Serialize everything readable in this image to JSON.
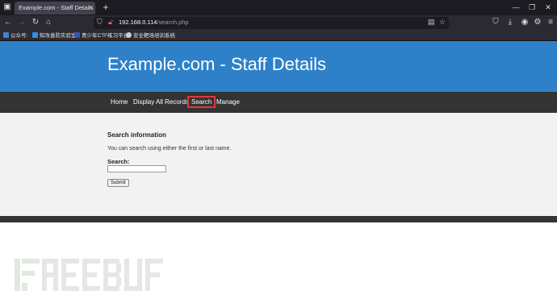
{
  "browser": {
    "tab_title": "Example.com - Staff Details - We",
    "tab_close": "×",
    "new_tab": "+",
    "url_host": "192.168.0.114",
    "url_path": "/search.php",
    "window_controls": [
      "—",
      "❐",
      "✕"
    ]
  },
  "bookmarks": [
    {
      "label": "公众号:",
      "color": "#4a7fd6"
    },
    {
      "label": "知攻善防实验室",
      "color": "#3a8ae0"
    },
    {
      "label": "青少年CTF练习平台",
      "color": "#3557a8"
    },
    {
      "label": "安全靶场培训系统",
      "color": "#cfcfcf"
    }
  ],
  "site": {
    "title": "Example.com - Staff Details",
    "menu": [
      {
        "label": "Home"
      },
      {
        "label": "Display All Records"
      },
      {
        "label": "Search"
      },
      {
        "label": "Manage"
      }
    ],
    "heading": "Search information",
    "description": "You can search using either the first or last name.",
    "search_label": "Search:",
    "search_value": "",
    "submit_label": "Submit"
  },
  "colors": {
    "header_blue": "#2e81c9",
    "menu_dark": "#333333",
    "active_outline": "#e0383e"
  }
}
